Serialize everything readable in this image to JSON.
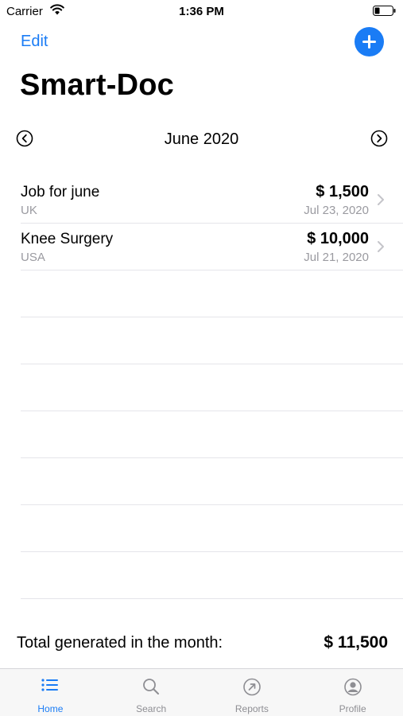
{
  "status_bar": {
    "carrier": "Carrier",
    "time": "1:36 PM"
  },
  "nav": {
    "edit_label": "Edit"
  },
  "title": "Smart-Doc",
  "month": "June 2020",
  "entries": [
    {
      "title": "Job for june",
      "subtitle": "UK",
      "amount": "$ 1,500",
      "date": "Jul 23, 2020"
    },
    {
      "title": "Knee Surgery",
      "subtitle": "USA",
      "amount": "$ 10,000",
      "date": "Jul 21, 2020"
    }
  ],
  "total": {
    "label": "Total generated in the month:",
    "value": "$ 11,500"
  },
  "tabs": [
    {
      "label": "Home",
      "icon": "list-icon",
      "active": true
    },
    {
      "label": "Search",
      "icon": "search-icon",
      "active": false
    },
    {
      "label": "Reports",
      "icon": "reports-icon",
      "active": false
    },
    {
      "label": "Profile",
      "icon": "profile-icon",
      "active": false
    }
  ],
  "colors": {
    "accent": "#1a7cf5",
    "secondary_text": "#9a9aa0"
  }
}
